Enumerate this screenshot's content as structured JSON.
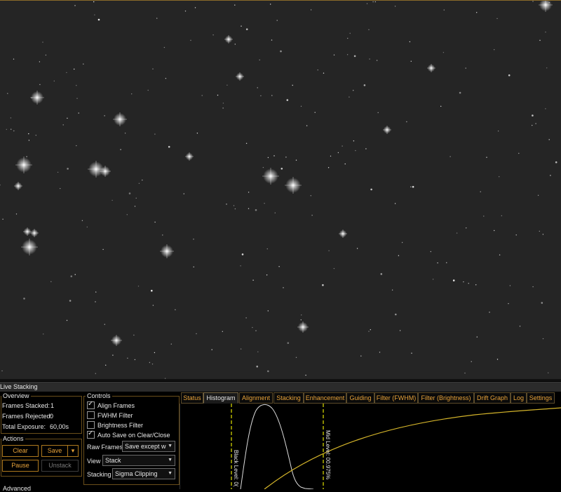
{
  "window": {
    "title": "Live Stacking"
  },
  "overview": {
    "title": "Overview",
    "frames_stacked_label": "Frames Stacked:",
    "frames_stacked_value": "1",
    "frames_rejected_label": "Frames Rejected:",
    "frames_rejected_value": "0",
    "total_exposure_label": "Total Exposure:",
    "total_exposure_value": "60,00s"
  },
  "actions": {
    "title": "Actions",
    "clear": "Clear",
    "save": "Save",
    "save_dropdown": "▾",
    "pause": "Pause",
    "unstack": "Unstack"
  },
  "advanced": {
    "title": "Advanced"
  },
  "controls": {
    "title": "Controls",
    "align_frames": {
      "label": "Align Frames",
      "checked": true
    },
    "fwhm_filter": {
      "label": "FWHM Filter",
      "checked": false
    },
    "brightness_filter": {
      "label": "Brightness Filter",
      "checked": false
    },
    "auto_save": {
      "label": "Auto Save on Clear/Close",
      "checked": true
    },
    "raw_frames_label": "Raw Frames",
    "raw_frames_value": "Save except w",
    "view_label": "View",
    "view_value": "Stack",
    "stacking_label": "Stacking",
    "stacking_value": "Sigma Clipping"
  },
  "tabs": [
    "Status",
    "Histogram",
    "Alignment",
    "Stacking",
    "Enhancement",
    "Guiding",
    "Filter (FWHM)",
    "Filter (Brightness)",
    "Drift Graph",
    "Log",
    "Settings"
  ],
  "active_tab": "Histogram",
  "histogram": {
    "black_level_label": "Black Level: 0(",
    "mid_level_label": "Mid Level: 00.975%",
    "marker_color": "#e0e000",
    "curve_color": "#d4b42a"
  },
  "colors": {
    "accent": "#e8a33a",
    "border": "#b07a1e",
    "sky": "#252525"
  }
}
